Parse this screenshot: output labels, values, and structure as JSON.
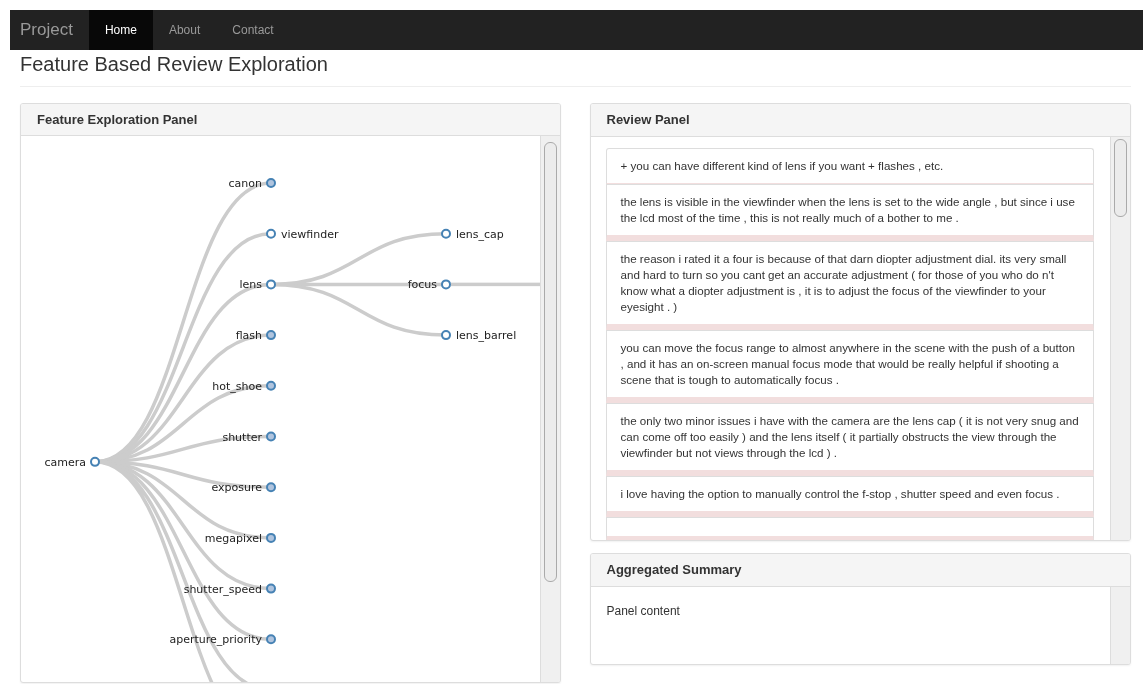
{
  "navbar": {
    "brand": "Project",
    "links": [
      {
        "label": "Home",
        "selected": true
      },
      {
        "label": "About",
        "selected": false
      },
      {
        "label": "Contact",
        "selected": false
      }
    ]
  },
  "page_title": "Feature Based Review Exploration",
  "feature_panel": {
    "title": "Feature Exploration Panel",
    "tree": {
      "label": "camera",
      "collapsed": false,
      "continues_below": true,
      "children": [
        {
          "label": "canon",
          "collapsed": true
        },
        {
          "label": "viewfinder",
          "collapsed": false
        },
        {
          "label": "lens",
          "collapsed": false,
          "children": [
            {
              "label": "lens_cap",
              "collapsed": false
            },
            {
              "label": "focus",
              "collapsed": false,
              "continues_right": true
            },
            {
              "label": "lens_barrel",
              "collapsed": false
            }
          ]
        },
        {
          "label": "flash",
          "collapsed": true
        },
        {
          "label": "hot_shoe",
          "collapsed": true
        },
        {
          "label": "shutter",
          "collapsed": true
        },
        {
          "label": "exposure",
          "collapsed": true
        },
        {
          "label": "megapixel",
          "collapsed": true
        },
        {
          "label": "shutter_speed",
          "collapsed": true
        },
        {
          "label": "aperture_priority",
          "collapsed": true
        }
      ]
    }
  },
  "review_panel": {
    "title": "Review Panel",
    "reviews": [
      "+ you can have different kind of lens if you want + flashes , etc.",
      "the lens is visible in the viewfinder when the lens is set to the wide angle , but since i use the lcd most of the time , this is not really much of a bother to me .",
      "the reason i rated it a four is because of that darn diopter adjustment dial. its very small and hard to turn so you cant get an accurate adjustment ( for those of you who do n't know what a diopter adjustment is , it is to adjust the focus of the viewfinder to your eyesight . )",
      "you can move the focus range to almost anywhere in the scene with the push of a button , and it has an on-screen manual focus mode that would be really helpful if shooting a scene that is tough to automatically focus .",
      "the only two minor issues i have with the camera are the lens cap ( it is not very snug and can come off too easily ) and the lens itself ( it partially obstructs the view through the viewfinder but not views through the lcd ) .",
      "i love having the option to manually control the f-stop , shutter speed and even focus ."
    ]
  },
  "summary_panel": {
    "title": "Aggregated Summary",
    "content": "Panel content"
  }
}
